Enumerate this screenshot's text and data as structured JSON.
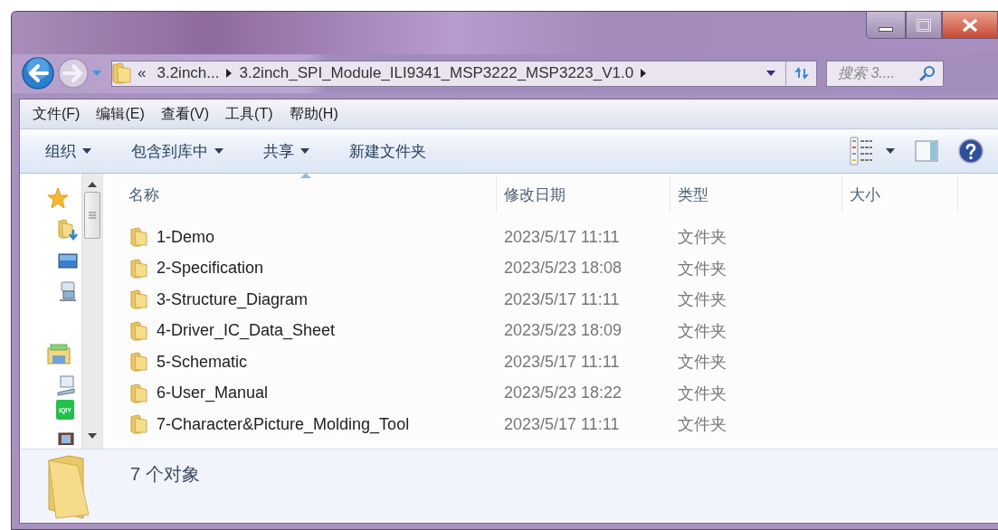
{
  "address_bar": {
    "overflow": "«",
    "segments": [
      "3.2inch...",
      "3.2inch_SPI_Module_ILI9341_MSP3222_MSP3223_V1.0"
    ]
  },
  "search": {
    "placeholder": "搜索 3...."
  },
  "menu_bar": [
    "文件(F)",
    "编辑(E)",
    "查看(V)",
    "工具(T)",
    "帮助(H)"
  ],
  "toolbar": [
    {
      "label": "组织",
      "dropdown": true
    },
    {
      "label": "包含到库中",
      "dropdown": true
    },
    {
      "label": "共享",
      "dropdown": true
    },
    {
      "label": "新建文件夹",
      "dropdown": false
    }
  ],
  "nav_pane": {
    "app_badge": "iQIY"
  },
  "table": {
    "columns": [
      {
        "label": "名称",
        "sorted": true
      },
      {
        "label": "修改日期",
        "sorted": false
      },
      {
        "label": "类型",
        "sorted": false
      },
      {
        "label": "大小",
        "sorted": false
      }
    ],
    "rows": [
      {
        "name": "1-Demo",
        "modified": "2023/5/17 11:11",
        "type": "文件夹"
      },
      {
        "name": "2-Specification",
        "modified": "2023/5/23 18:08",
        "type": "文件夹"
      },
      {
        "name": "3-Structure_Diagram",
        "modified": "2023/5/17 11:11",
        "type": "文件夹"
      },
      {
        "name": "4-Driver_IC_Data_Sheet",
        "modified": "2023/5/23 18:09",
        "type": "文件夹"
      },
      {
        "name": "5-Schematic",
        "modified": "2023/5/17 11:11",
        "type": "文件夹"
      },
      {
        "name": "6-User_Manual",
        "modified": "2023/5/23 18:22",
        "type": "文件夹"
      },
      {
        "name": "7-Character&Picture_Molding_Tool",
        "modified": "2023/5/17 11:11",
        "type": "文件夹"
      }
    ]
  },
  "status_bar": {
    "count": "7 个对象"
  }
}
